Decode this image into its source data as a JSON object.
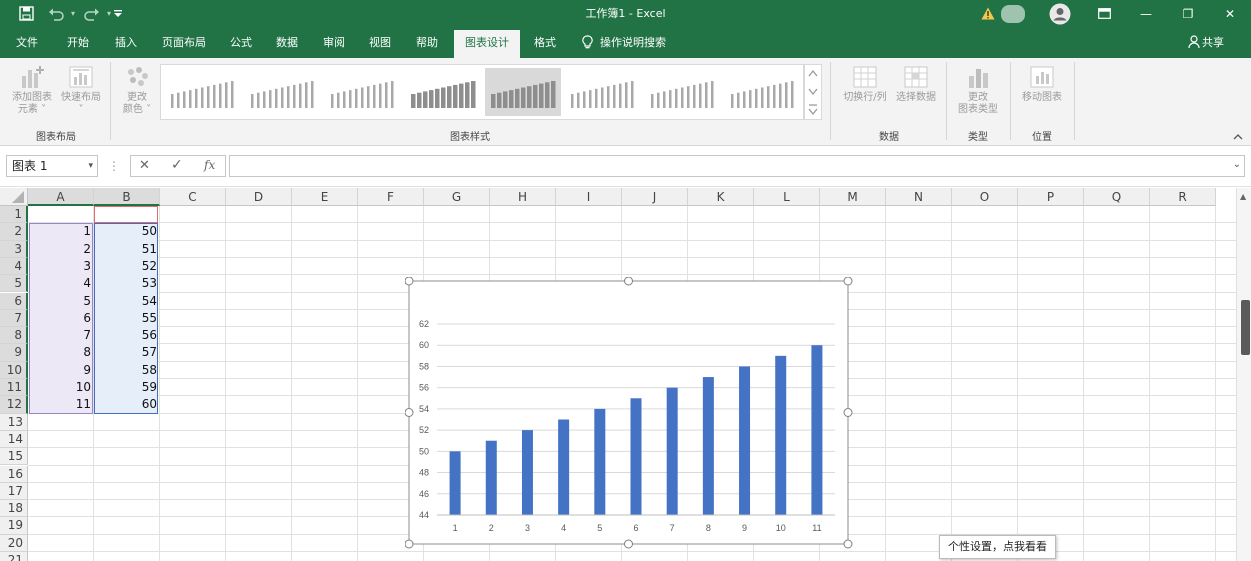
{
  "titlebar": {
    "title": "工作簿1  -  Excel",
    "save_icon": "save-icon",
    "undo_icon": "undo-icon",
    "redo_icon": "redo-icon",
    "customize_icon": "customize-quick-access-icon",
    "warning_icon": "warning-icon",
    "account_icon": "account-avatar-icon",
    "ribbon_display_icon": "ribbon-display-options-icon",
    "minimize": "—",
    "restore": "❐",
    "close": "✕"
  },
  "tabs": [
    {
      "label": "文件"
    },
    {
      "label": "开始"
    },
    {
      "label": "插入"
    },
    {
      "label": "页面布局"
    },
    {
      "label": "公式"
    },
    {
      "label": "数据"
    },
    {
      "label": "审阅"
    },
    {
      "label": "视图"
    },
    {
      "label": "帮助"
    },
    {
      "label": "图表设计",
      "active": true
    },
    {
      "label": "格式"
    }
  ],
  "tell_me": {
    "icon": "lightbulb-icon",
    "label": "操作说明搜索"
  },
  "share": {
    "icon": "person-icon",
    "label": "共享"
  },
  "ribbon": {
    "chart_layouts": {
      "add_element": {
        "line1": "添加图表",
        "line2": "元素 ˅"
      },
      "quick_layout": {
        "line1": "快速布局",
        "line2": "˅"
      },
      "group_label": "图表布局"
    },
    "change_colors": {
      "line1": "更改",
      "line2": "颜色 ˅"
    },
    "chart_styles_label": "图表样式",
    "data": {
      "switch": "切换行/列",
      "select": "选择数据",
      "group_label": "数据"
    },
    "type": {
      "line1": "更改",
      "line2": "图表类型",
      "group_label": "类型"
    },
    "location": {
      "label": "移动图表",
      "group_label": "位置"
    }
  },
  "formula_bar": {
    "name_box": "图表 1",
    "cancel_icon": "✕",
    "enter_icon": "✓",
    "fx": "fx",
    "formula": ""
  },
  "sheet": {
    "columns": [
      "A",
      "B",
      "C",
      "D",
      "E",
      "F",
      "G",
      "H",
      "I",
      "J",
      "K",
      "L",
      "M",
      "N",
      "O",
      "P",
      "Q",
      "R"
    ],
    "rows": [
      "1",
      "2",
      "3",
      "4",
      "5",
      "6",
      "7",
      "8",
      "9",
      "10",
      "11",
      "12",
      "13",
      "14",
      "15",
      "16",
      "17",
      "18",
      "19",
      "20",
      "21"
    ],
    "colA": [
      "",
      "1",
      "2",
      "3",
      "4",
      "5",
      "6",
      "7",
      "8",
      "9",
      "10",
      "11"
    ],
    "colB": [
      "",
      "50",
      "51",
      "52",
      "53",
      "54",
      "55",
      "56",
      "57",
      "58",
      "59",
      "60"
    ]
  },
  "chart_data": {
    "type": "bar",
    "categories": [
      "1",
      "2",
      "3",
      "4",
      "5",
      "6",
      "7",
      "8",
      "9",
      "10",
      "11"
    ],
    "values": [
      50,
      51,
      52,
      53,
      54,
      55,
      56,
      57,
      58,
      59,
      60
    ],
    "yticks": [
      "44",
      "46",
      "48",
      "50",
      "52",
      "54",
      "56",
      "58",
      "60",
      "62"
    ],
    "ylim": [
      44,
      62
    ],
    "grid": true,
    "bar_color": "#4472c4"
  },
  "tooltip": "个性设置，点我看看",
  "colors": {
    "excel_green": "#217346",
    "selection_green": "#217346",
    "col_a_fill": "#ede8f5",
    "col_b_fill": "#e6eef9"
  }
}
